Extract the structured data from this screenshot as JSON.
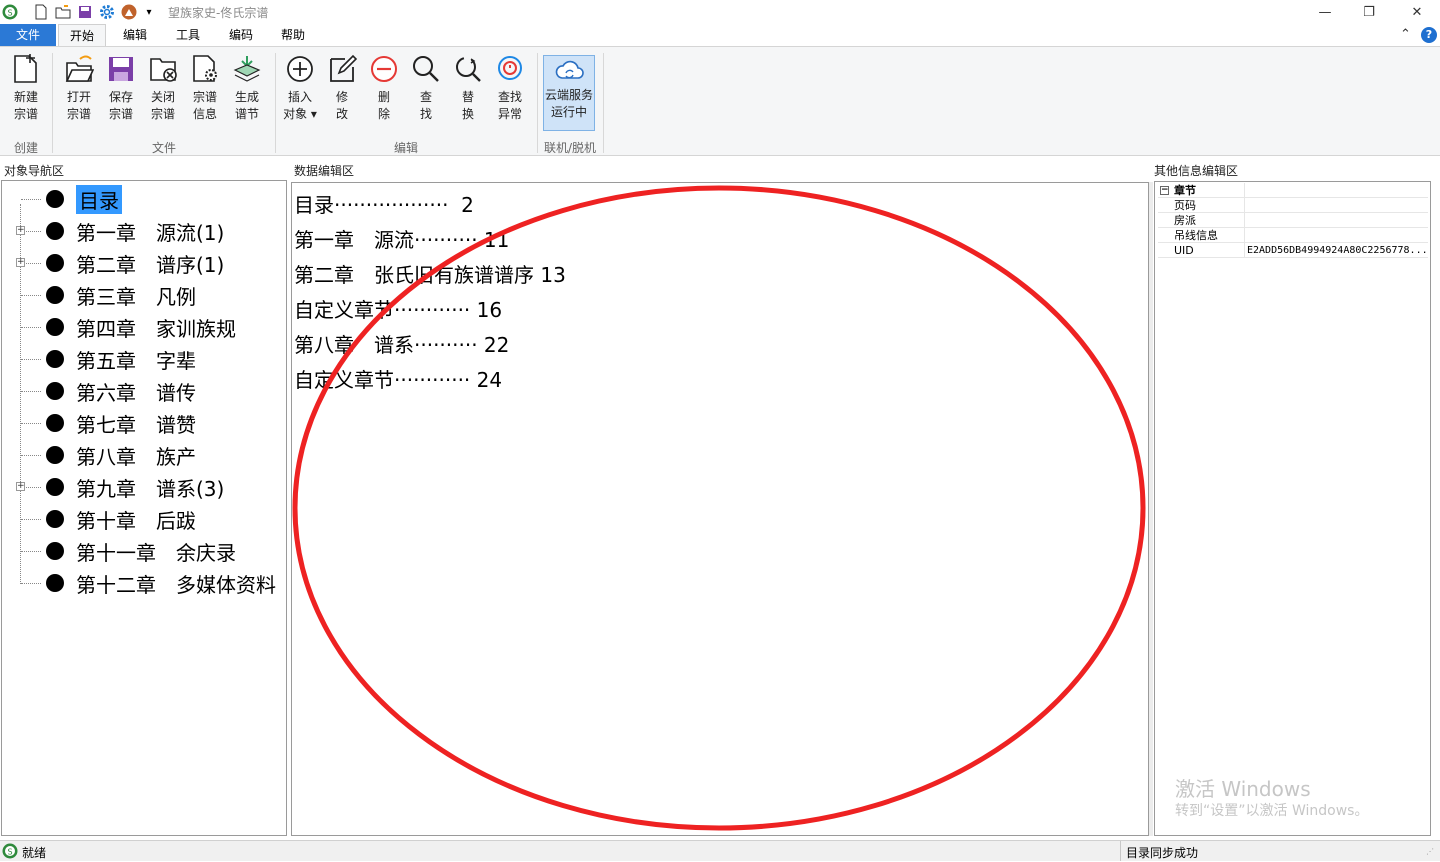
{
  "window": {
    "title": "望族家史-佟氏宗谱",
    "controls": {
      "minimize": "—",
      "restore": "❐",
      "close": "✕"
    }
  },
  "tabs": [
    {
      "label": "文件"
    },
    {
      "label": "开始"
    },
    {
      "label": "编辑"
    },
    {
      "label": "工具"
    },
    {
      "label": "编码"
    },
    {
      "label": "帮助"
    }
  ],
  "ribbon_right": {
    "collapse": "⌃",
    "help": "?"
  },
  "ribbon": {
    "buttons": [
      {
        "line1": "新建",
        "line2": "宗谱",
        "icon": "new-doc-icon"
      },
      {
        "line1": "打开",
        "line2": "宗谱",
        "icon": "open-folder-icon"
      },
      {
        "line1": "保存",
        "line2": "宗谱",
        "icon": "save-icon"
      },
      {
        "line1": "关闭",
        "line2": "宗谱",
        "icon": "close-folder-icon"
      },
      {
        "line1": "宗谱",
        "line2": "信息",
        "icon": "doc-settings-icon"
      },
      {
        "line1": "生成",
        "line2": "谱节",
        "icon": "generate-layers-icon"
      },
      {
        "line1": "插入",
        "line2": "对象 ▾",
        "icon": "insert-icon"
      },
      {
        "line1": "修",
        "line2": "改",
        "icon": "edit-icon"
      },
      {
        "line1": "删",
        "line2": "除",
        "icon": "delete-icon"
      },
      {
        "line1": "查",
        "line2": "找",
        "icon": "search-icon"
      },
      {
        "line1": "替",
        "line2": "换",
        "icon": "replace-icon"
      },
      {
        "line1": "查找",
        "line2": "异常",
        "icon": "find-error-icon"
      },
      {
        "line1": "云端服务",
        "line2": "运行中",
        "icon": "cloud-sync-icon"
      }
    ],
    "groups": [
      "创建",
      "文件",
      "编辑",
      "联机/脱机"
    ]
  },
  "panes": {
    "nav_title": "对象导航区",
    "editor_title": "数据编辑区",
    "info_title": "其他信息编辑区"
  },
  "tree": [
    {
      "label": "目录",
      "expandable": false,
      "selected": true
    },
    {
      "label": "第一章　源流(1)",
      "expandable": true
    },
    {
      "label": "第二章　谱序(1)",
      "expandable": true
    },
    {
      "label": "第三章　凡例",
      "expandable": false
    },
    {
      "label": "第四章　家训族规",
      "expandable": false
    },
    {
      "label": "第五章　字辈",
      "expandable": false
    },
    {
      "label": "第六章　谱传",
      "expandable": false
    },
    {
      "label": "第七章　谱赞",
      "expandable": false
    },
    {
      "label": "第八章　族产",
      "expandable": false
    },
    {
      "label": "第九章　谱系(3)",
      "expandable": true
    },
    {
      "label": "第十章　后跋",
      "expandable": false
    },
    {
      "label": "第十一章　余庆录",
      "expandable": false
    },
    {
      "label": "第十二章　多媒体资料",
      "expandable": false
    }
  ],
  "toc": [
    "目录··················  2",
    "第一章　源流·········· 11",
    "第二章　张氏旧有族谱谱序 13",
    "自定义章节············ 16",
    "第八章　谱系·········· 22",
    "自定义章节············ 24"
  ],
  "properties": {
    "category": "章节",
    "rows": [
      {
        "key": "页码",
        "value": ""
      },
      {
        "key": "房派",
        "value": ""
      },
      {
        "key": "吊线信息",
        "value": ""
      },
      {
        "key": "UID",
        "value": "E2ADD56DB4994924A80C2256778..."
      }
    ]
  },
  "status": {
    "left": "就绪",
    "right": "目录同步成功"
  },
  "watermark": {
    "line1": "激活 Windows",
    "line2": "转到“设置”以激活 Windows。"
  },
  "colors": {
    "accent": "#2b79d6",
    "selection": "#3399ff",
    "annotation": "#ee2222"
  }
}
